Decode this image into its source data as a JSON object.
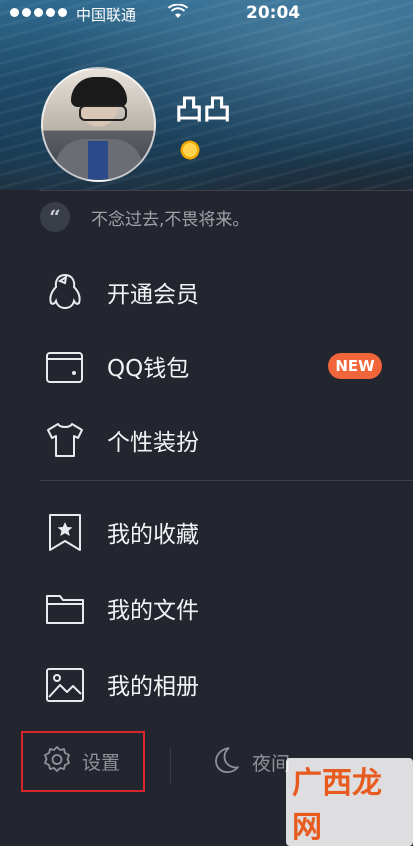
{
  "status_bar": {
    "carrier": "中国联通",
    "time": "20:04"
  },
  "profile": {
    "nickname": "凸凸",
    "signature": "不念过去,不畏将来。",
    "quote_mark": "“"
  },
  "menu": {
    "items": [
      {
        "label": "开通会员",
        "icon": "penguin-icon"
      },
      {
        "label": "QQ钱包",
        "icon": "wallet-icon",
        "badge": "NEW"
      },
      {
        "label": "个性装扮",
        "icon": "tshirt-icon"
      },
      {
        "label": "我的收藏",
        "icon": "bookmark-star-icon"
      },
      {
        "label": "我的文件",
        "icon": "folder-icon"
      },
      {
        "label": "我的相册",
        "icon": "photo-icon"
      }
    ]
  },
  "bottom_bar": {
    "settings_label": "设置",
    "night_label": "夜间"
  },
  "watermark": {
    "text": "广西龙网"
  },
  "colors": {
    "background": "#23262e",
    "accent_badge": "#f0663a",
    "highlight_border": "#d8262d"
  }
}
